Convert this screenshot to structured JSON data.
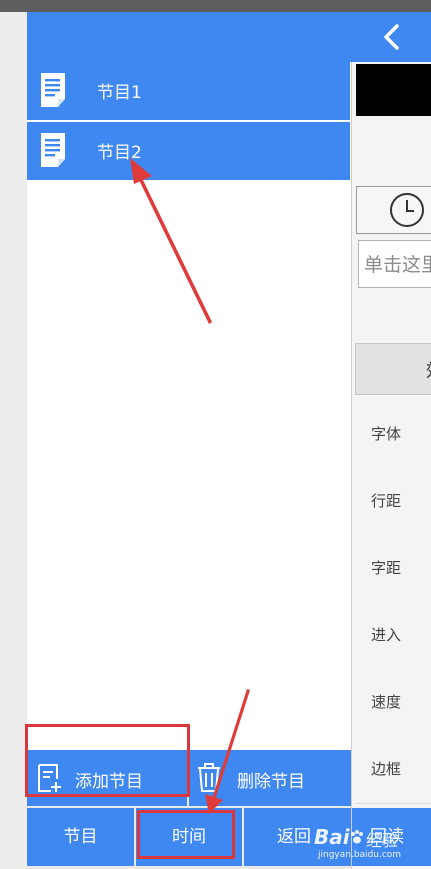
{
  "header": {
    "back_icon": "chevron-left-icon"
  },
  "programs": [
    {
      "label": "节目1",
      "icon": "document-icon"
    },
    {
      "label": "节目2",
      "icon": "document-icon"
    }
  ],
  "actions": {
    "add_label": "添加节目",
    "add_icon": "add-note-icon",
    "delete_label": "删除节目",
    "delete_icon": "trash-icon"
  },
  "tabs": {
    "program": "节目",
    "time": "时间",
    "back": "返回"
  },
  "right_panel": {
    "clock_icon": "clock-icon",
    "text_input_placeholder": "单击这里",
    "header_partial": "效",
    "properties": [
      "字体",
      "行距",
      "字距",
      "进入",
      "速度",
      "边框"
    ],
    "readback_label": "回读"
  },
  "watermark": {
    "brand": "Bai",
    "suffix": "经验",
    "url": "jingyan.baidu.com"
  },
  "colors": {
    "primary": "#3f88f2",
    "highlight": "#d9363e"
  }
}
